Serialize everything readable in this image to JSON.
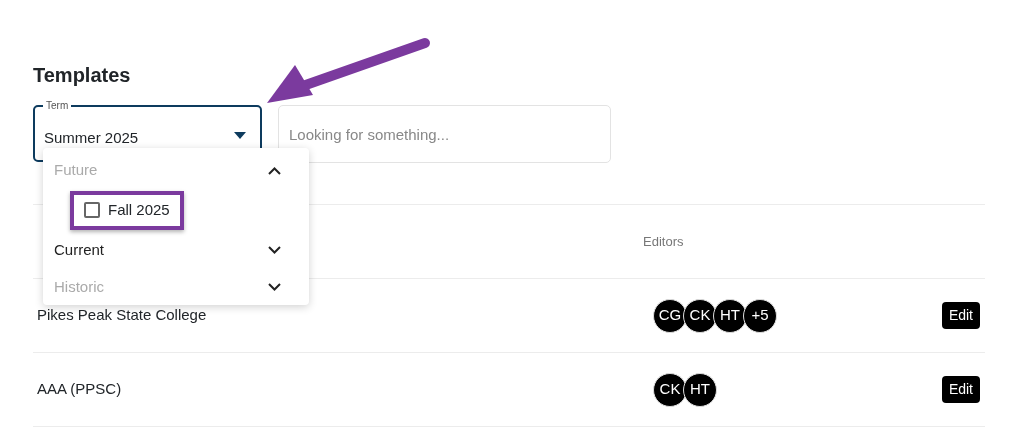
{
  "page_title": "Templates",
  "term_field": {
    "label": "Term",
    "value": "Summer 2025",
    "expanded": true
  },
  "search": {
    "placeholder": "Looking for something..."
  },
  "term_menu": [
    {
      "label": "Future",
      "disabled": true,
      "expanded": true,
      "options": [
        {
          "label": "Fall 2025",
          "checked": false,
          "highlighted": true
        }
      ]
    },
    {
      "label": "Current",
      "disabled": false,
      "expanded": false
    },
    {
      "label": "Historic",
      "disabled": true,
      "expanded": false
    }
  ],
  "table": {
    "columns": [
      "Editors"
    ],
    "rows": [
      {
        "name": "Pikes Peak State College",
        "editors": [
          "CG",
          "CK",
          "HT",
          "+5"
        ],
        "action": "Edit"
      },
      {
        "name": "AAA (PPSC)",
        "editors": [
          "CK",
          "HT"
        ],
        "action": "Edit"
      }
    ]
  },
  "annotation": {
    "kind": "arrow"
  }
}
